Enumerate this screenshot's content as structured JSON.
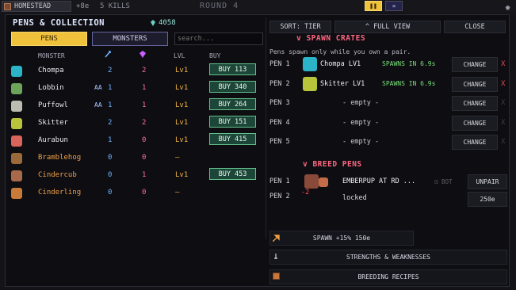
{
  "hud": {
    "location": "HOMESTEAD",
    "income": "+8e",
    "kills": "5 KILLS",
    "round": "ROUND 4",
    "pause_glyph": "❚❚",
    "speed_glyph": "»"
  },
  "left": {
    "title": "PENS & COLLECTION",
    "currency": "4058",
    "tabs": {
      "pens": "PENS",
      "monsters": "MONSTERS"
    },
    "search_placeholder": "search...",
    "headers": {
      "monster": "MONSTER",
      "lvl": "LVL",
      "buy": "BUY"
    },
    "rows": [
      {
        "name": "Chompa",
        "aa": "",
        "b": "2",
        "p": "2",
        "lvl": "Lv1",
        "buy": "BUY 113",
        "color": "#e8e8f0",
        "avatar": "#2bb3c8"
      },
      {
        "name": "Lobbin",
        "aa": "AA",
        "b": "1",
        "p": "1",
        "lvl": "Lv1",
        "buy": "BUY 340",
        "color": "#e8e8f0",
        "avatar": "#6ca45a"
      },
      {
        "name": "Puffowl",
        "aa": "AA",
        "b": "1",
        "p": "1",
        "lvl": "Lv1",
        "buy": "BUY 264",
        "color": "#e8e8f0",
        "avatar": "#bcbcb2"
      },
      {
        "name": "Skitter",
        "aa": "",
        "b": "2",
        "p": "2",
        "lvl": "Lv1",
        "buy": "BUY 151",
        "color": "#e8e8f0",
        "avatar": "#b8c43a"
      },
      {
        "name": "Aurabun",
        "aa": "",
        "b": "1",
        "p": "0",
        "lvl": "Lv1",
        "buy": "BUY 415",
        "color": "#e8e8f0",
        "avatar": "#d8645a"
      },
      {
        "name": "Bramblehog",
        "aa": "",
        "b": "0",
        "p": "0",
        "lvl": "–",
        "buy": "",
        "color": "#f0a048",
        "avatar": "#9a6a3a"
      },
      {
        "name": "Cindercub",
        "aa": "",
        "b": "0",
        "p": "1",
        "lvl": "Lv1",
        "buy": "BUY 453",
        "color": "#f0a048",
        "avatar": "#a86a4a"
      },
      {
        "name": "Cinderling",
        "aa": "",
        "b": "0",
        "p": "0",
        "lvl": "–",
        "buy": "",
        "color": "#f0a048",
        "avatar": "#c87a38"
      }
    ]
  },
  "right": {
    "sort_label": "SORT: TIER",
    "full_view_label": "^ FULL VIEW",
    "close_label": "CLOSE",
    "spawn_title": "v SPAWN CRATES",
    "spawn_note": "Pens spawn only while you own a pair.",
    "pens": [
      {
        "label": "PEN 1",
        "name": "Chompa LV1",
        "spawn": "SPAWNS IN 6.9s",
        "change": "CHANGE",
        "x": "X",
        "avatar": "#2bb3c8",
        "x_color": "#e04848"
      },
      {
        "label": "PEN 2",
        "name": "Skitter LV1",
        "spawn": "SPAWNS IN 6.9s",
        "change": "CHANGE",
        "x": "X",
        "avatar": "#b8c43a",
        "x_color": "#e04848"
      },
      {
        "label": "PEN 3",
        "empty": "- empty -",
        "change": "CHANGE",
        "x": "X",
        "x_color": "#3a3a44"
      },
      {
        "label": "PEN 4",
        "empty": "- empty -",
        "change": "CHANGE",
        "x": "X",
        "x_color": "#3a3a44"
      },
      {
        "label": "PEN 5",
        "empty": "- empty -",
        "change": "CHANGE",
        "x": "X",
        "x_color": "#3a3a44"
      }
    ],
    "breed_title": "v BREED PENS",
    "breed": {
      "pen1_label": "PEN 1",
      "pen1_name": "EMBERPUP AT RD ...",
      "bot_label": "BOT",
      "unpair_label": "UNPAIR",
      "pen2_label": "PEN 2",
      "pen2_count": "-2",
      "pen2_status": "locked",
      "pen2_cost": "250e"
    },
    "spawn_bonus": "SPAWN +15% 150e",
    "strengths": "STRENGTHS & WEAKNESSES",
    "recipes": "BREEDING RECIPES"
  }
}
